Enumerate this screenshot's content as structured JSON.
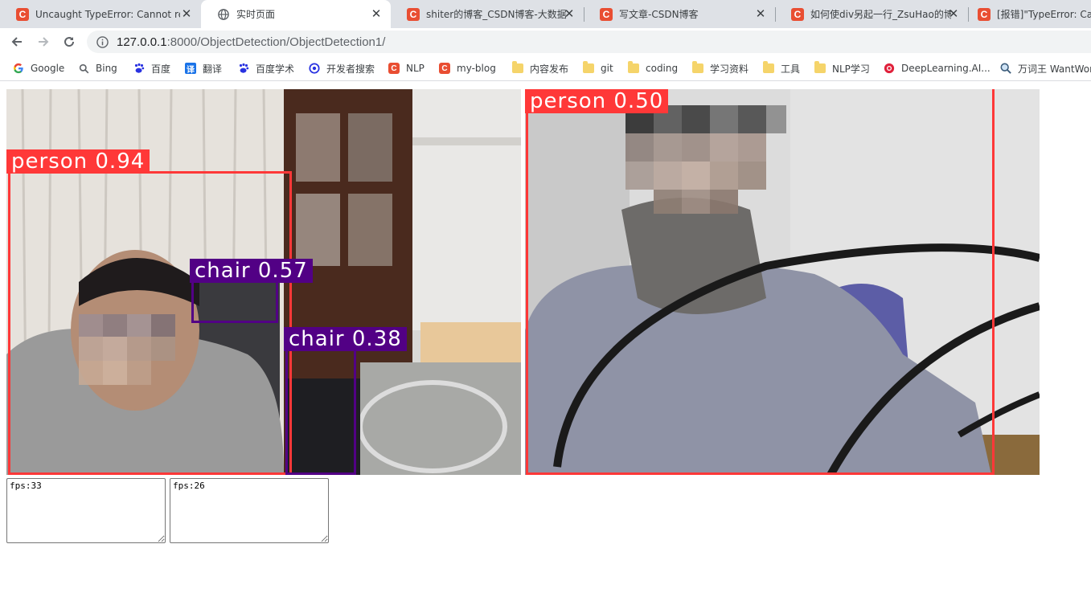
{
  "browser": {
    "tabs": [
      {
        "title": "Uncaught TypeError: Cannot read",
        "favicon": "csdn-icon",
        "active": false
      },
      {
        "title": "实时页面",
        "favicon": "globe-icon",
        "active": true
      },
      {
        "title": "shiter的博客_CSDN博客-大数据",
        "favicon": "csdn-icon",
        "active": false
      },
      {
        "title": "写文章-CSDN博客",
        "favicon": "csdn-icon",
        "active": false
      },
      {
        "title": "如何使div另起一行_ZsuHao的博",
        "favicon": "csdn-icon",
        "active": false
      },
      {
        "title": "[报错]\"TypeError: Can",
        "favicon": "csdn-icon",
        "active": false
      }
    ],
    "close_glyph": "✕",
    "url_host": "127.0.0.1",
    "url_path": ":8000/ObjectDetection/ObjectDetection1/",
    "bookmarks": [
      {
        "label": "Google",
        "icon": "google-icon"
      },
      {
        "label": "Bing",
        "icon": "search-icon"
      },
      {
        "label": "百度",
        "icon": "baidu-icon"
      },
      {
        "label": "翻译",
        "icon": "translate-icon"
      },
      {
        "label": "百度学术",
        "icon": "baidu-icon"
      },
      {
        "label": "开发者搜索",
        "icon": "dev-search-icon"
      },
      {
        "label": "NLP",
        "icon": "csdn-icon"
      },
      {
        "label": "my-blog",
        "icon": "csdn-icon"
      },
      {
        "label": "内容发布",
        "icon": "folder-icon"
      },
      {
        "label": "git",
        "icon": "folder-icon"
      },
      {
        "label": "coding",
        "icon": "folder-icon"
      },
      {
        "label": "学习资料",
        "icon": "folder-icon"
      },
      {
        "label": "工具",
        "icon": "folder-icon"
      },
      {
        "label": "NLP学习",
        "icon": "folder-icon"
      },
      {
        "label": "DeepLearning.AI...",
        "icon": "deeplearning-icon"
      },
      {
        "label": "万词王 WantWords",
        "icon": "magnifier-icon"
      }
    ]
  },
  "page": {
    "stream1": {
      "detections": [
        {
          "label": "person 0.94",
          "color": "#ff3838"
        },
        {
          "label": "chair 0.57",
          "color": "#520085"
        },
        {
          "label": "chair 0.38",
          "color": "#520085"
        }
      ]
    },
    "stream2": {
      "detections": [
        {
          "label": "person 0.50",
          "color": "#ff3838"
        }
      ]
    },
    "fps1": "fps:33",
    "fps2": "fps:26"
  }
}
